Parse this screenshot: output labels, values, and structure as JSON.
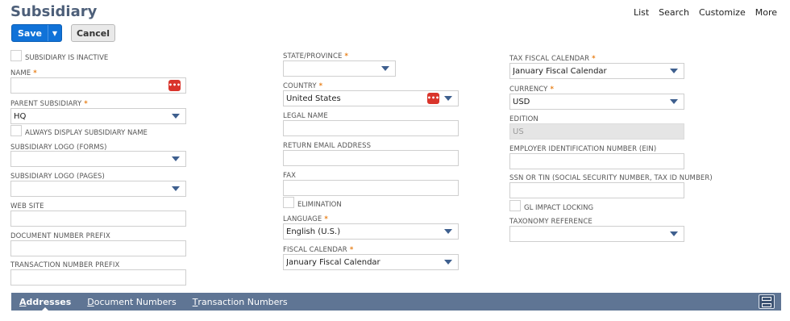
{
  "header": {
    "title": "Subsidiary",
    "links": [
      "List",
      "Search",
      "Customize",
      "More"
    ]
  },
  "toolbar": {
    "save_label": "Save",
    "cancel_label": "Cancel"
  },
  "form": {
    "subsidiary_inactive": {
      "label": "SUBSIDIARY IS INACTIVE",
      "checked": false
    },
    "name": {
      "label": "NAME",
      "required": "*",
      "value": ""
    },
    "parent_subsidiary": {
      "label": "PARENT SUBSIDIARY",
      "required": "*",
      "value": "HQ"
    },
    "always_display_name": {
      "label": "ALWAYS DISPLAY SUBSIDIARY NAME",
      "checked": false
    },
    "logo_forms": {
      "label": "SUBSIDIARY LOGO (FORMS)",
      "value": ""
    },
    "logo_pages": {
      "label": "SUBSIDIARY LOGO (PAGES)",
      "value": ""
    },
    "web_site": {
      "label": "WEB SITE",
      "value": ""
    },
    "doc_number_prefix": {
      "label": "DOCUMENT NUMBER PREFIX",
      "value": ""
    },
    "txn_number_prefix": {
      "label": "TRANSACTION NUMBER PREFIX",
      "value": ""
    },
    "state_province": {
      "label": "STATE/PROVINCE",
      "required": "*",
      "value": ""
    },
    "country": {
      "label": "COUNTRY",
      "required": "*",
      "value": "United States"
    },
    "legal_name": {
      "label": "LEGAL NAME",
      "value": ""
    },
    "return_email": {
      "label": "RETURN EMAIL ADDRESS",
      "value": ""
    },
    "fax": {
      "label": "FAX",
      "value": ""
    },
    "elimination": {
      "label": "ELIMINATION",
      "checked": false
    },
    "language": {
      "label": "LANGUAGE",
      "required": "*",
      "value": "English (U.S.)"
    },
    "fiscal_calendar": {
      "label": "FISCAL CALENDAR",
      "required": "*",
      "value": "January Fiscal Calendar"
    },
    "tax_fiscal_calendar": {
      "label": "TAX FISCAL CALENDAR",
      "required": "*",
      "value": "January Fiscal Calendar"
    },
    "currency": {
      "label": "CURRENCY",
      "required": "*",
      "value": "USD"
    },
    "edition": {
      "label": "EDITION",
      "value": "US"
    },
    "ein": {
      "label": "EMPLOYER IDENTIFICATION NUMBER (EIN)",
      "value": ""
    },
    "ssn_tin": {
      "label": "SSN OR TIN (SOCIAL SECURITY NUMBER, TAX ID NUMBER)",
      "value": ""
    },
    "gl_impact_locking": {
      "label": "GL IMPACT LOCKING",
      "checked": false
    },
    "taxonomy_reference": {
      "label": "TAXONOMY REFERENCE",
      "value": ""
    }
  },
  "subtabs": {
    "addresses": {
      "first": "A",
      "rest": "ddresses"
    },
    "document_numbers": {
      "first": "D",
      "rest": "ocument Numbers"
    },
    "transaction_numbers": {
      "first": "T",
      "rest": "ransaction Numbers"
    },
    "active": "Addresses"
  },
  "icons": [
    "chevron-down-icon",
    "dots-icon",
    "layout-icon"
  ],
  "colors": {
    "accent": "#1072d8",
    "title": "#4d5f79",
    "subtab_bar": "#5f7594",
    "required": "#e8801a",
    "dots_button": "#d9342b"
  }
}
